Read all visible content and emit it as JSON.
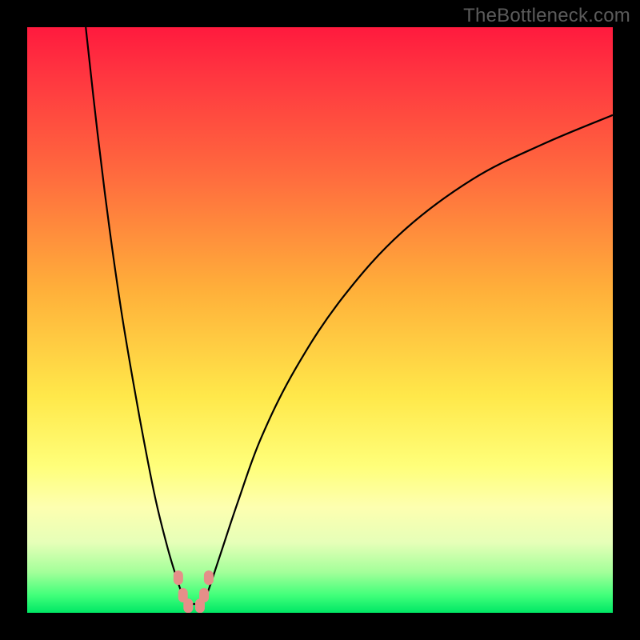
{
  "attribution": "TheBottleneck.com",
  "colors": {
    "frame": "#000000",
    "gradient_top": "#ff1a3e",
    "gradient_bottom": "#00e765",
    "curve": "#000000",
    "marker": "#e58f89"
  },
  "chart_data": {
    "type": "line",
    "title": "",
    "xlabel": "",
    "ylabel": "",
    "xlim": [
      0,
      100
    ],
    "ylim": [
      0,
      100
    ],
    "grid": false,
    "legend": false,
    "series": [
      {
        "name": "left-branch",
        "x": [
          10,
          12,
          14,
          16,
          18,
          20,
          22,
          24,
          25.5,
          26.5,
          27
        ],
        "y": [
          100,
          82,
          66,
          52,
          40,
          29,
          19,
          11,
          6,
          3,
          1.5
        ]
      },
      {
        "name": "right-branch",
        "x": [
          30,
          31,
          33,
          36,
          40,
          46,
          54,
          64,
          76,
          88,
          100
        ],
        "y": [
          1.5,
          4,
          10,
          19,
          30,
          42,
          54,
          65,
          74,
          80,
          85
        ]
      }
    ],
    "floor_segment": {
      "name": "valley-floor",
      "x": [
        27,
        30
      ],
      "y": [
        1.5,
        1.5
      ]
    },
    "markers": [
      {
        "name": "left-marker-upper",
        "x": 25.8,
        "y": 6.0
      },
      {
        "name": "left-marker-lower",
        "x": 26.6,
        "y": 3.0
      },
      {
        "name": "right-marker-upper",
        "x": 31.0,
        "y": 6.0
      },
      {
        "name": "right-marker-lower",
        "x": 30.2,
        "y": 3.0
      },
      {
        "name": "floor-marker-left",
        "x": 27.5,
        "y": 1.2
      },
      {
        "name": "floor-marker-right",
        "x": 29.5,
        "y": 1.2
      }
    ]
  }
}
